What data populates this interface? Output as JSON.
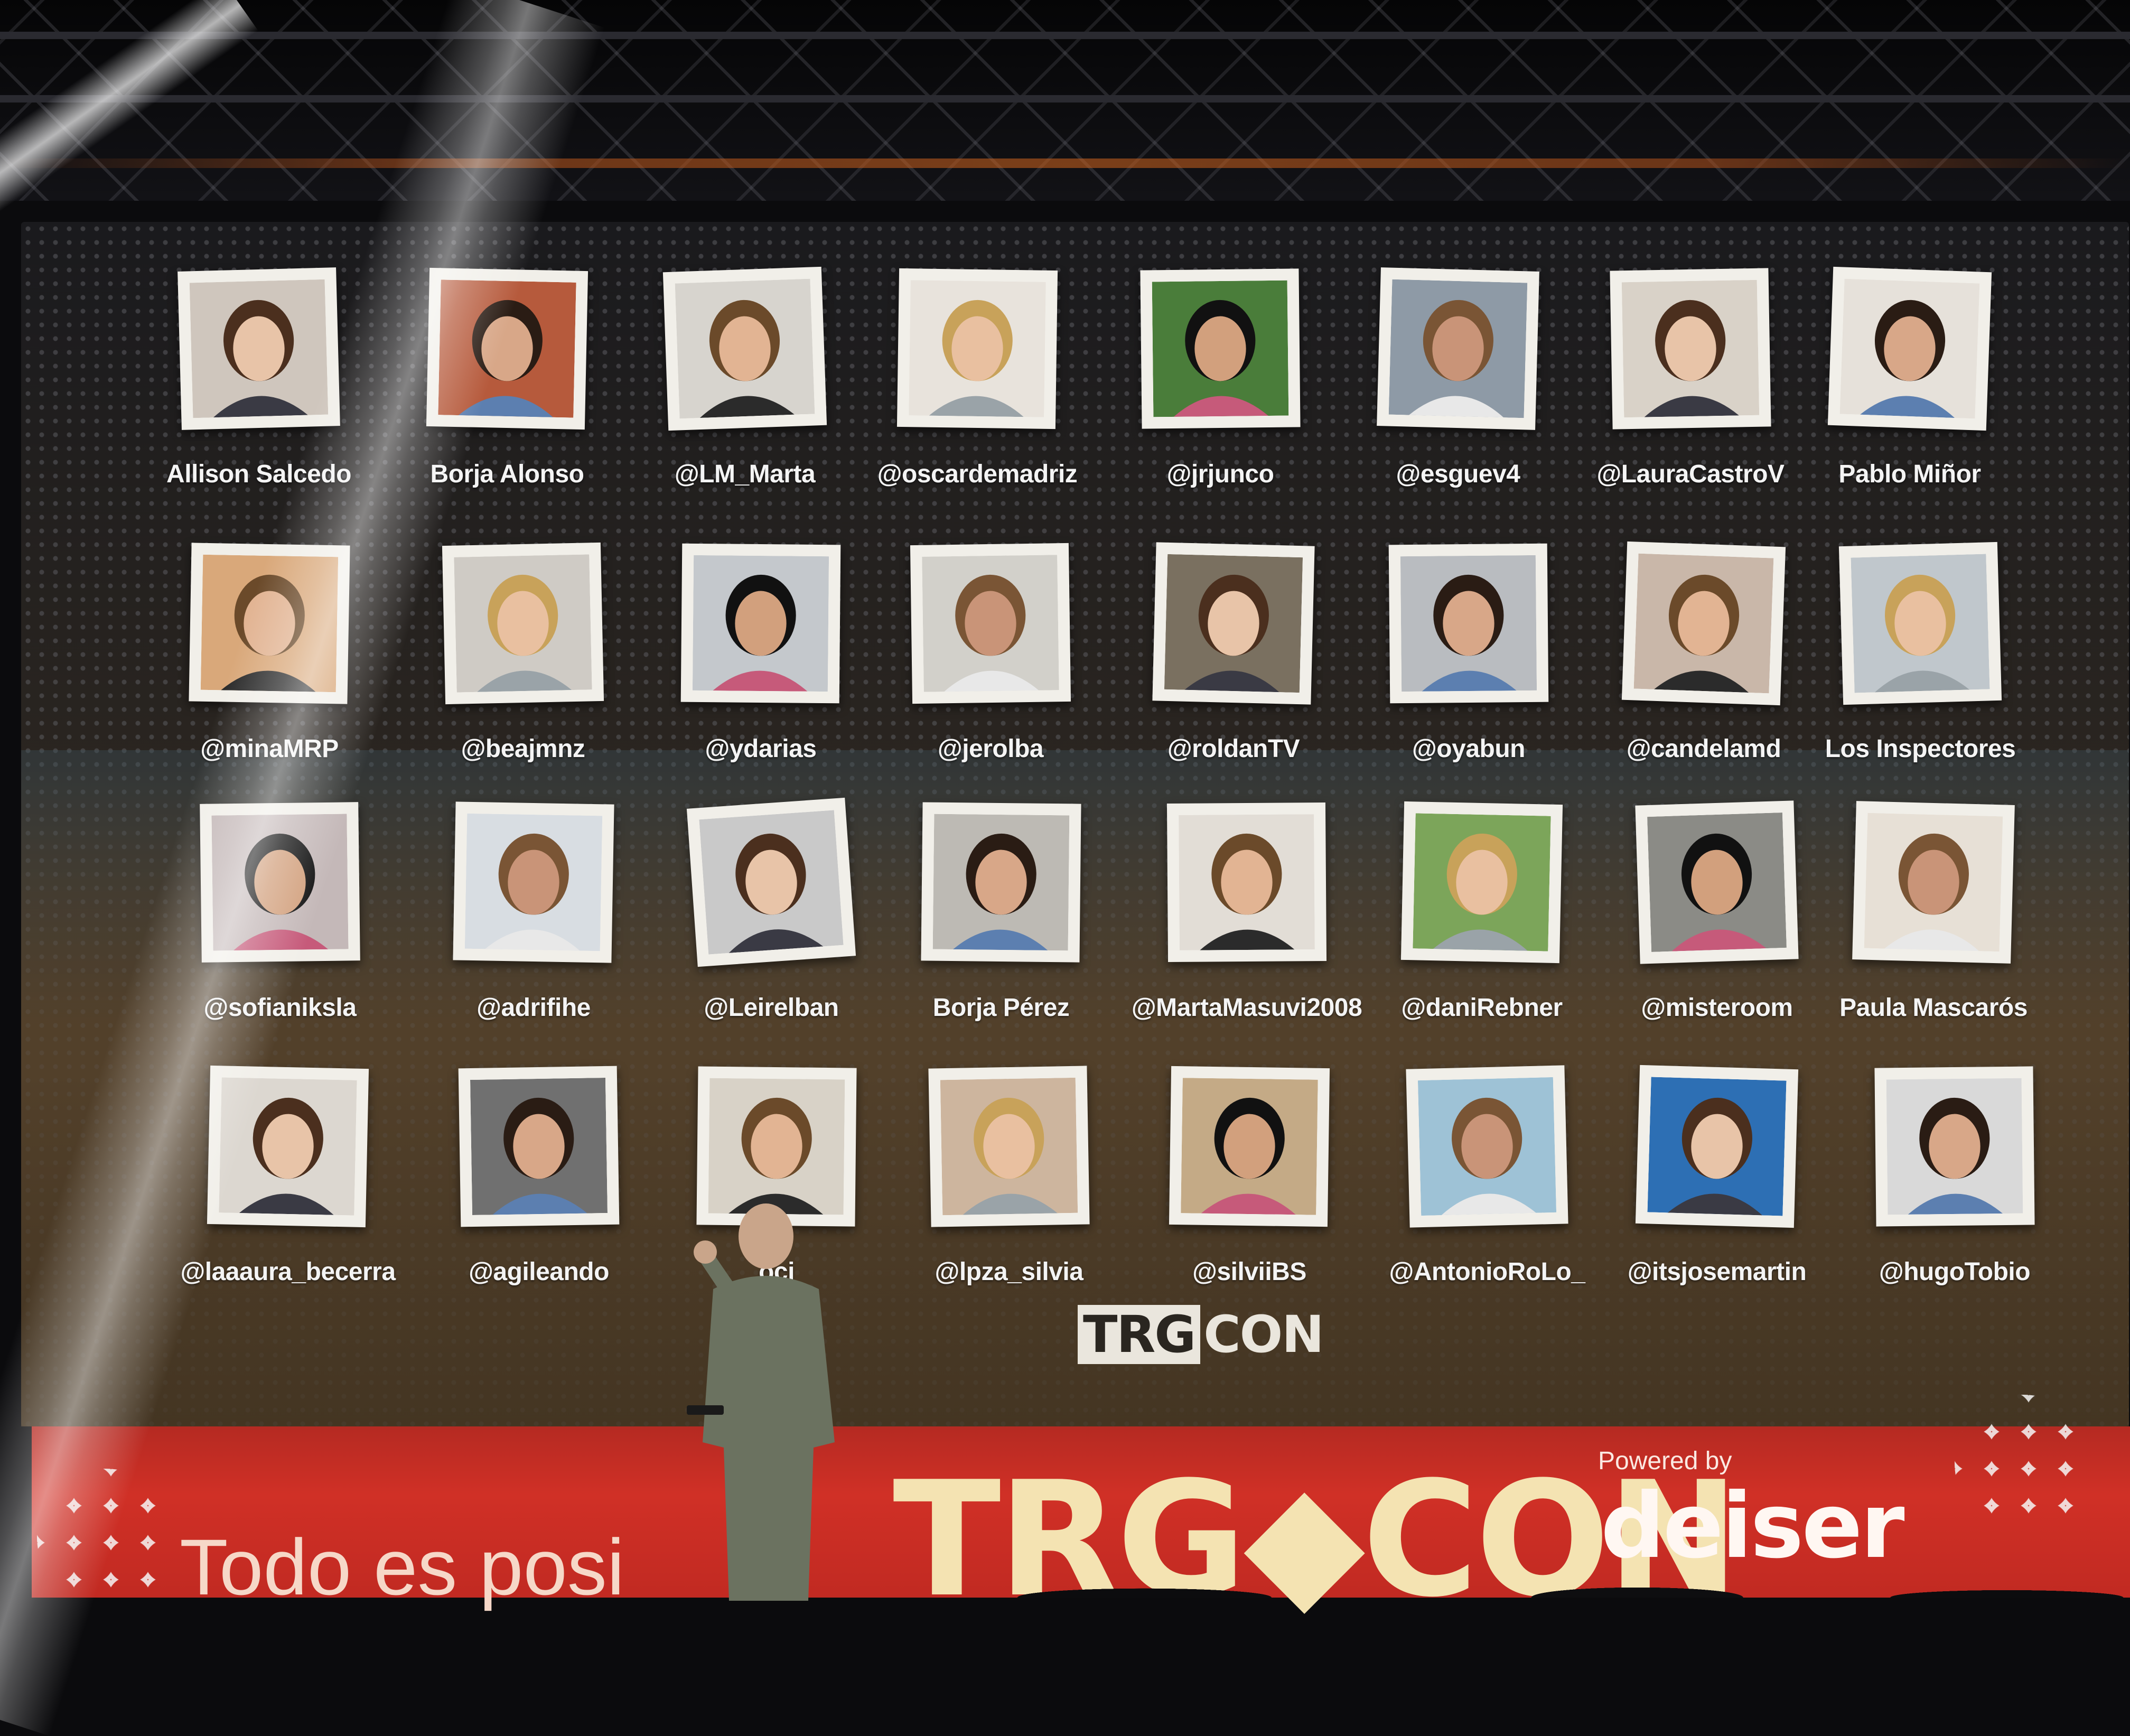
{
  "screen": {
    "rows": [
      [
        "Allison Salcedo",
        "Borja Alonso",
        "@LM_Marta",
        "@oscardemadriz",
        "@jrjunco",
        "@esguev4",
        "@LauraCastroV",
        "Pablo Miñor"
      ],
      [
        "@minaMRP",
        "@beajmnz",
        "@ydarias",
        "@jerolba",
        "@roldanTV",
        "@oyabun",
        "@candelamd",
        "Los Inspectores"
      ],
      [
        "@sofianiksla",
        "@adrifihe",
        "@Leirelban",
        "Borja Pérez",
        "@MartaMasuvi2008",
        "@daniRebner",
        "@misteroom",
        "Paula Mascarós"
      ],
      [
        "@laaaura_becerra",
        "@agileando",
        "oci",
        "@lpza_silvia",
        "@silviiBS",
        "@AntonioRoLo_",
        "@itsjosemartin",
        "@hugoTobio"
      ]
    ],
    "logo": {
      "left": "TRG",
      "right": "CON"
    }
  },
  "banner": {
    "slogan": "Todo es posi",
    "logo": "TRG◆CON",
    "powered_by": "Powered by",
    "sponsor": "deiser"
  },
  "colors": {
    "banner": "#d03026",
    "label": "#f4f4f4",
    "tile": "#f1efe9"
  }
}
